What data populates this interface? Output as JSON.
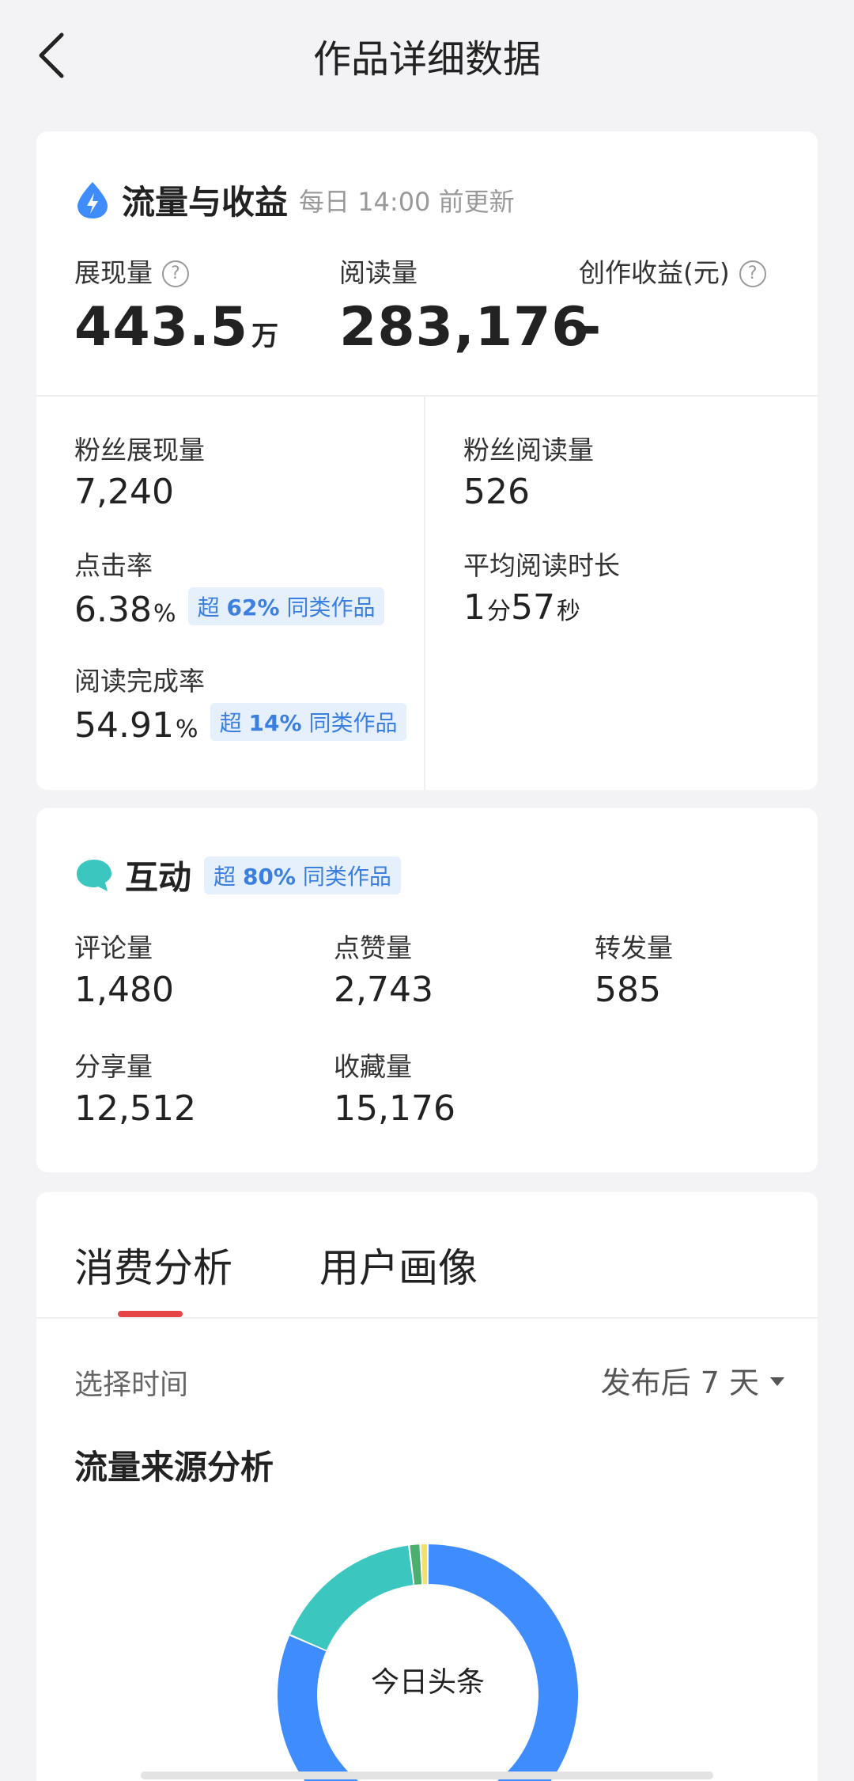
{
  "nav": {
    "title": "作品详细数据"
  },
  "traffic": {
    "title": "流量与收益",
    "subtitle": "每日 14:00 前更新",
    "impressions": {
      "label": "展现量",
      "value": "443.5",
      "unit": "万"
    },
    "reads": {
      "label": "阅读量",
      "value": "283,176"
    },
    "earnings": {
      "label": "创作收益(元)",
      "value": "-"
    },
    "fan_impressions": {
      "label": "粉丝展现量",
      "value": "7,240"
    },
    "fan_reads": {
      "label": "粉丝阅读量",
      "value": "526"
    },
    "ctr": {
      "label": "点击率",
      "value": "6.38",
      "unit": "%",
      "badge_prefix": "超",
      "badge_pct": "62%",
      "badge_suffix": "同类作品"
    },
    "avg_time": {
      "label": "平均阅读时长",
      "min": "1",
      "min_unit": "分",
      "sec": "57",
      "sec_unit": "秒"
    },
    "completion": {
      "label": "阅读完成率",
      "value": "54.91",
      "unit": "%",
      "badge_prefix": "超",
      "badge_pct": "14%",
      "badge_suffix": "同类作品"
    }
  },
  "interaction": {
    "title": "互动",
    "badge_prefix": "超",
    "badge_pct": "80%",
    "badge_suffix": "同类作品",
    "comments": {
      "label": "评论量",
      "value": "1,480"
    },
    "likes": {
      "label": "点赞量",
      "value": "2,743"
    },
    "reposts": {
      "label": "转发量",
      "value": "585"
    },
    "shares": {
      "label": "分享量",
      "value": "12,512"
    },
    "favorites": {
      "label": "收藏量",
      "value": "15,176"
    }
  },
  "analysis": {
    "tabs": [
      {
        "label": "消费分析",
        "active": true
      },
      {
        "label": "用户画像",
        "active": false
      }
    ],
    "select_time_label": "选择时间",
    "time_value": "发布后 7 天",
    "flow_title": "流量来源分析",
    "donut_center": "今日头条"
  },
  "chart_data": {
    "type": "pie",
    "categories": [
      "",
      "",
      "",
      ""
    ],
    "values": [
      81.5,
      16.5,
      1.2,
      0.8
    ],
    "colors": [
      "#3f8cff",
      "#3cc6c0",
      "#4caf6f",
      "#f2e06a"
    ]
  }
}
